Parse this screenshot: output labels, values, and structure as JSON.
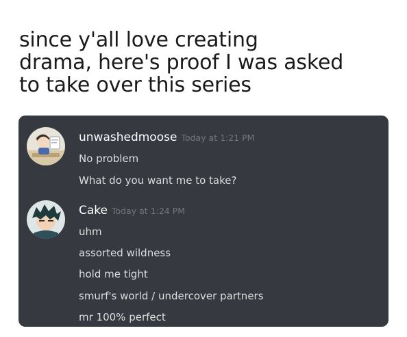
{
  "caption": {
    "lines": [
      "since y'all love creating",
      "drama, here's proof I was asked",
      "to take over this series"
    ]
  },
  "chat": {
    "groups": [
      {
        "username": "unwashedmoose",
        "timestamp": "Today at 1:21 PM",
        "avatar": "unwashedmoose-avatar",
        "messages": [
          "No problem",
          "What do you want me to take?"
        ]
      },
      {
        "username": "Cake",
        "timestamp": "Today at 1:24 PM",
        "avatar": "cake-avatar",
        "messages": [
          "uhm",
          "assorted wildness",
          "hold me tight",
          "smurf's world / undercover partners",
          "mr 100% perfect"
        ]
      }
    ]
  },
  "colors": {
    "chat_background": "#36393f",
    "username": "#ffffff",
    "timestamp": "#72767d",
    "message_text": "#dcddde"
  }
}
